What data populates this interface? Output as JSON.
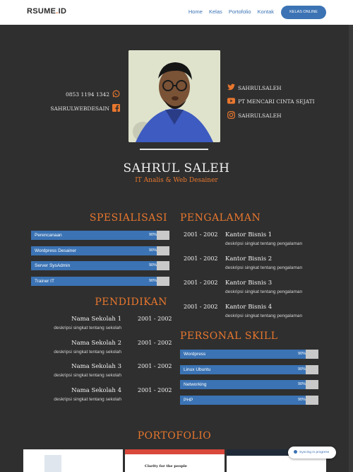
{
  "nav": {
    "logo_main": "RSUME",
    "logo_dot": ".",
    "logo_end": "ID",
    "links": [
      "Home",
      "Kelas",
      "Portofolio",
      "Kontak"
    ],
    "button": "KELAS ONLINE"
  },
  "profile": {
    "name": "SAHRUL SALEH",
    "role": "IT Analis & Web Desainer",
    "phone": "0853 1194 1342",
    "facebook": "SAHRULWEBDESAIN",
    "twitter": "SAHRULSALEH",
    "youtube": "PT MENCARI CINTA SEJATI",
    "instagram": "SAHRULSALEH"
  },
  "spesialisasi": {
    "title": "SPESIALISASI",
    "items": [
      {
        "label": "Perencanaan",
        "pct": "90%",
        "value": 0.9
      },
      {
        "label": "Wordpress Desainer",
        "pct": "90%",
        "value": 0.9
      },
      {
        "label": "Server SysAdmin",
        "pct": "90%",
        "value": 0.9
      },
      {
        "label": "Trainer IT",
        "pct": "90%",
        "value": 0.9
      }
    ]
  },
  "pendidikan": {
    "title": "PENDIDIKAN",
    "items": [
      {
        "title": "Nama Sekolah 1",
        "desc": "deskripsi singkat tentang sekolah",
        "date": "2001 - 2002"
      },
      {
        "title": "Nama Sekolah 2",
        "desc": "deskripsi singkat tentang sekolah",
        "date": "2001 - 2002"
      },
      {
        "title": "Nama Sekolah 3",
        "desc": "deskripsi singkat tentang sekolah",
        "date": "2001 - 2002"
      },
      {
        "title": "Nama Sekolah 4",
        "desc": "deskripsi singkat tentang sekolah",
        "date": "2001 - 2002"
      }
    ]
  },
  "pengalaman": {
    "title": "PENGALAMAN",
    "items": [
      {
        "date": "2001 - 2002",
        "title": "Kantor Bisnis 1",
        "desc": "deskripsi singkat tentang pengalaman"
      },
      {
        "date": "2001 - 2002",
        "title": "Kantor Bisnis 2",
        "desc": "deskripsi singkat tentang pengalaman"
      },
      {
        "date": "2001 - 2002",
        "title": "Kantor Bisnis 3",
        "desc": "deskripsi singkat tentang pengalaman"
      },
      {
        "date": "2001 - 2002",
        "title": "Kantor Bisnis 4",
        "desc": "deskripsi singkat tentang pengalaman"
      }
    ]
  },
  "personal_skill": {
    "title": "PERSONAL SKILL",
    "items": [
      {
        "label": "Wordpress",
        "pct": "90%",
        "value": 0.9
      },
      {
        "label": "Linux Ubuntu",
        "pct": "90%",
        "value": 0.9
      },
      {
        "label": "Networking",
        "pct": "90%",
        "value": 0.9
      },
      {
        "label": "PHP",
        "pct": "90%",
        "value": 0.9
      }
    ]
  },
  "portofolio": {
    "title": "PORTOFOLIO",
    "thumb2_text": "Clarity for the people"
  },
  "toast": {
    "text": "Syncing in progress"
  },
  "colors": {
    "accent": "#e8772e",
    "bar": "#3b73b4",
    "track": "#c9c9c9",
    "background": "#2f2f2f"
  },
  "icons": {
    "phone": "whatsapp-icon",
    "facebook": "facebook-icon",
    "twitter": "twitter-icon",
    "youtube": "youtube-icon",
    "instagram": "instagram-icon",
    "photo": "profile-photo"
  }
}
